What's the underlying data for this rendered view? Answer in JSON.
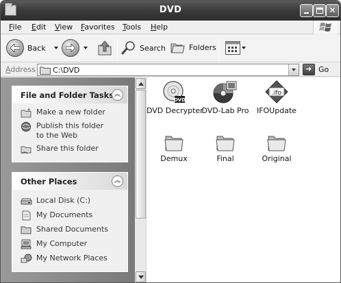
{
  "window": {
    "title": "DVD"
  },
  "menu": [
    "File",
    "Edit",
    "View",
    "Favorites",
    "Tools",
    "Help"
  ],
  "toolbar": {
    "back_label": "Back",
    "search_label": "Search",
    "folders_label": "Folders"
  },
  "address": {
    "label": "Address",
    "value": "C:\\DVD",
    "go_label": "Go"
  },
  "file_tasks": {
    "title": "File and Folder Tasks",
    "items": [
      {
        "label": "Make a new folder",
        "icon": "new-folder-icon"
      },
      {
        "label": "Publish this folder to the Web",
        "icon": "publish-web-icon"
      },
      {
        "label": "Share this folder",
        "icon": "share-folder-icon"
      }
    ]
  },
  "other_places": {
    "title": "Other Places",
    "items": [
      {
        "label": "Local Disk (C:)",
        "icon": "local-disk-icon"
      },
      {
        "label": "My Documents",
        "icon": "my-documents-icon"
      },
      {
        "label": "Shared Documents",
        "icon": "shared-documents-icon"
      },
      {
        "label": "My Computer",
        "icon": "my-computer-icon"
      },
      {
        "label": "My Network Places",
        "icon": "network-places-icon"
      }
    ]
  },
  "files": [
    {
      "name": "DVD Decrypter",
      "icon": "dvd-decrypter-icon"
    },
    {
      "name": "DVD-Lab Pro",
      "icon": "dvd-lab-pro-icon"
    },
    {
      "name": "IFOUpdate",
      "icon": "ifo-update-icon",
      "badge": ".ifo"
    },
    {
      "name": "Demux",
      "icon": "folder-icon"
    },
    {
      "name": "Final",
      "icon": "folder-icon"
    },
    {
      "name": "Original",
      "icon": "folder-icon"
    }
  ]
}
